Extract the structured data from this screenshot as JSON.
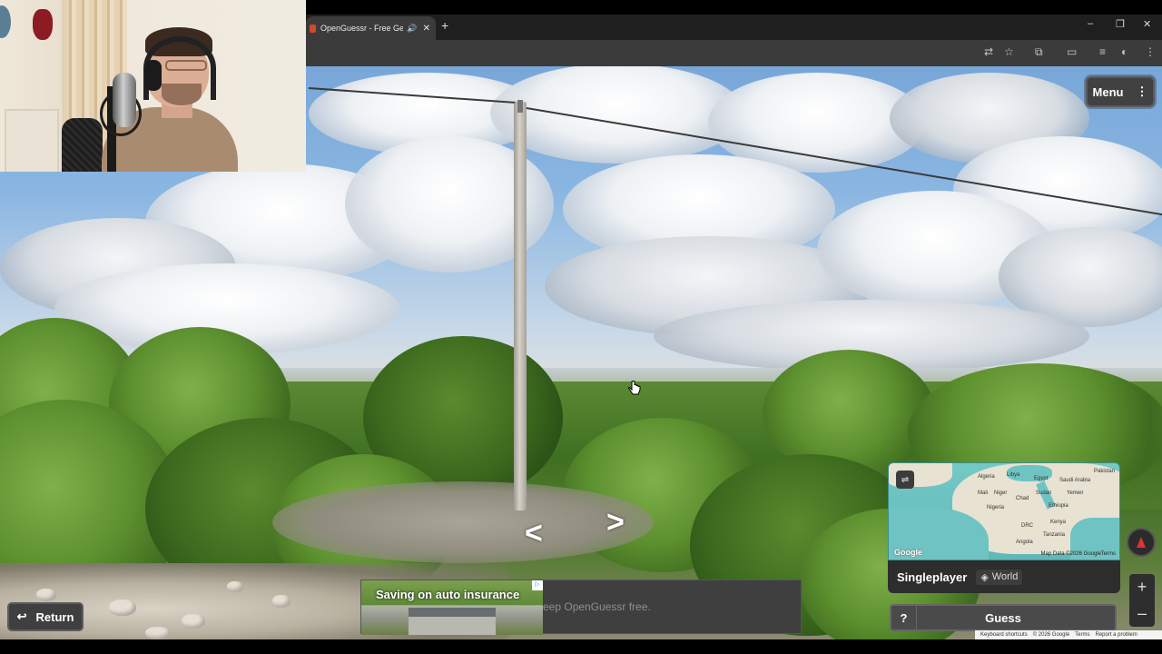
{
  "browser": {
    "tab_title": "OpenGuessr - Free GeoGue",
    "tab_audio_icon": "speaker-icon",
    "tab_close": "✕",
    "new_tab": "+",
    "window_controls": {
      "minimize": "–",
      "restore": "❐",
      "close": "✕"
    }
  },
  "game": {
    "menu_label": "Menu",
    "menu_icon": "⋮",
    "map": {
      "labels": [
        "Libya",
        "Egypt",
        "Saudi Arabia",
        "Pakistan",
        "Algeria",
        "Mali",
        "Niger",
        "Chad",
        "Sudan",
        "Yemen",
        "Nigeria",
        "Ethiopia",
        "DRC",
        "Kenya",
        "Tanzania",
        "Angola"
      ],
      "google": "Google",
      "attribution": "Map Data ©2026 Google",
      "terms": "Terms"
    },
    "mode": {
      "title": "Singleplayer",
      "tag": "World"
    },
    "guess": {
      "help": "?",
      "label": "Guess"
    },
    "return_label": "Return",
    "zoom": {
      "in": "+",
      "out": "–"
    }
  },
  "ad": {
    "headline": "Saving on auto insurance",
    "text": "eep OpenGuessr free."
  },
  "status_bar": {
    "items": [
      "Keyboard shortcuts",
      "© 2026 Google",
      "Terms",
      "Report a problem"
    ]
  },
  "colors": {
    "accent_red": "#d33",
    "panel": "#2d2d2d",
    "map_water": "#6cc2c0"
  }
}
